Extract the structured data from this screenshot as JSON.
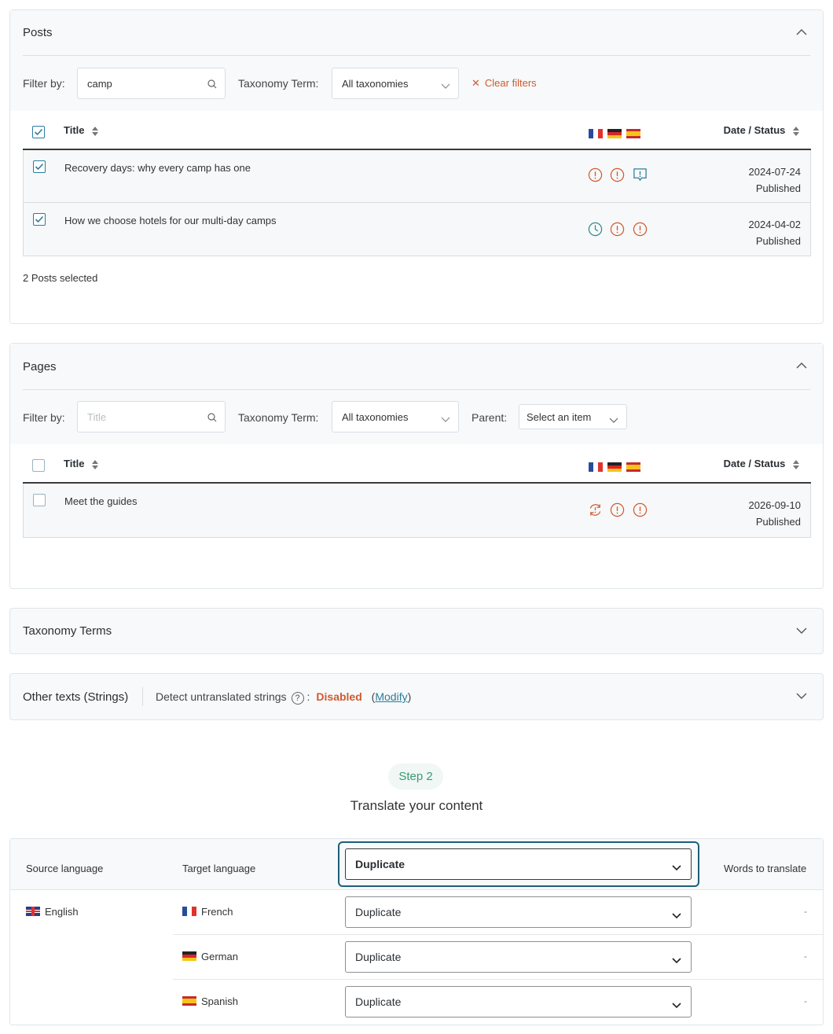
{
  "posts": {
    "title": "Posts",
    "filter_label": "Filter by:",
    "search_value": "camp",
    "taxonomy_label": "Taxonomy Term:",
    "taxonomy_value": "All taxonomies",
    "clear_filters": "Clear filters",
    "col_title": "Title",
    "col_date": "Date / Status",
    "rows": [
      {
        "title": "Recovery days: why every camp has one",
        "date": "2024-07-24",
        "status": "Published",
        "checked": true
      },
      {
        "title": "How we choose hotels for our multi-day camps",
        "date": "2024-04-02",
        "status": "Published",
        "checked": true
      }
    ],
    "selected_count": "2 Posts selected"
  },
  "pages": {
    "title": "Pages",
    "filter_label": "Filter by:",
    "search_placeholder": "Title",
    "taxonomy_label": "Taxonomy Term:",
    "taxonomy_value": "All taxonomies",
    "parent_label": "Parent:",
    "parent_value": "Select an item",
    "col_title": "Title",
    "col_date": "Date / Status",
    "rows": [
      {
        "title": "Meet the guides",
        "date": "2026-09-10",
        "status": "Published",
        "checked": false
      }
    ]
  },
  "taxonomy_terms": {
    "title": "Taxonomy Terms"
  },
  "strings": {
    "title": "Other texts (Strings)",
    "detect_label": "Detect untranslated strings",
    "question": "?",
    "colon": ":",
    "status": "Disabled",
    "modify_open": "(",
    "modify": "Modify",
    "modify_close": ")"
  },
  "step": {
    "pill": "Step 2",
    "title": "Translate your content"
  },
  "translate": {
    "col_source": "Source language",
    "col_target": "Target language",
    "col_words": "Words to translate",
    "header_method": "Duplicate",
    "source_language": "English",
    "targets": [
      {
        "language": "French",
        "method": "Duplicate",
        "words": "-"
      },
      {
        "language": "German",
        "method": "Duplicate",
        "words": "-"
      },
      {
        "language": "Spanish",
        "method": "Duplicate",
        "words": "-"
      }
    ]
  },
  "colors": {
    "accent": "#2b7c9c",
    "warning": "#d05a2e",
    "success": "#3a9b74"
  }
}
